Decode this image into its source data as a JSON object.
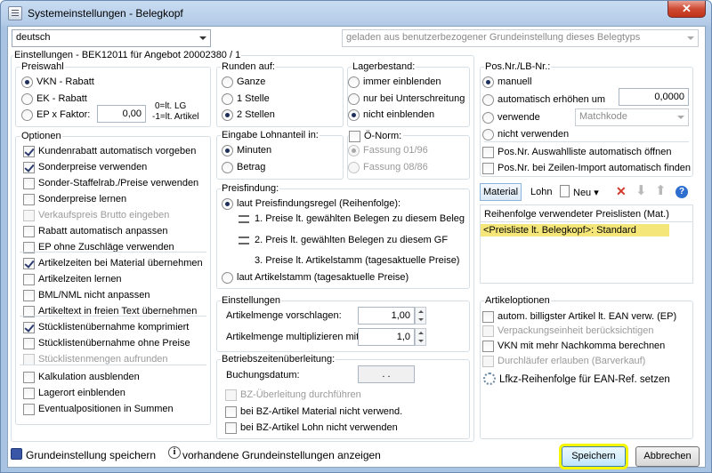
{
  "window": {
    "title": "Systemeinstellungen - Belegkopf",
    "close": "✕"
  },
  "top": {
    "language": "deutsch",
    "template": "geladen aus benutzerbezogener Grundeinstellung dieses Belegtyps"
  },
  "settings_caption": "Einstellungen - BEK12011 für Angebot 20002380 / 1",
  "preiswahl": {
    "title": "Preiswahl",
    "opt1": "VKN - Rabatt",
    "opt2": "EK - Rabatt",
    "opt3": "EP x Faktor:",
    "factor": "0,00",
    "note1": "0=lt. LG",
    "note2": "-1=lt. Artikel"
  },
  "runden": {
    "title": "Runden auf:",
    "opt1": "Ganze",
    "opt2": "1 Stelle",
    "opt3": "2 Stellen"
  },
  "lager": {
    "title": "Lagerbestand:",
    "opt1": "immer einblenden",
    "opt2": "nur bei Unterschreitung",
    "opt3": "nicht einblenden"
  },
  "posnr": {
    "title": "Pos.Nr./LB-Nr.:",
    "opt1": "manuell",
    "opt2": "automatisch erhöhen um",
    "value": "0,0000",
    "opt3": "verwende",
    "matchcode": "Matchkode",
    "opt4": "nicht verwenden",
    "chk1": "Pos.Nr. Auswahlliste automatisch öffnen",
    "chk2": "Pos.Nr. bei Zeilen-Import automatisch finden"
  },
  "optionen": {
    "title": "Optionen",
    "items": [
      "Kundenrabatt automatisch vorgeben",
      "Sonderpreise verwenden",
      "Sonder-Staffelrab./Preise verwenden",
      "Sonderpreise lernen",
      "Verkaufspreis Brutto eingeben",
      "Rabatt automatisch anpassen",
      "EP ohne Zuschläge verwenden",
      "Artikelzeiten bei Material übernehmen",
      "Artikelzeiten lernen",
      "BML/NML nicht anpassen",
      "Artikeltext in freien Text übernehmen",
      "Stücklistenübernahme komprimiert",
      "Stücklistenübernahme ohne Preise",
      "Stücklistenmengen aufrunden",
      "Kalkulation ausblenden",
      "Lagerort einblenden",
      "Eventualpositionen in Summen"
    ]
  },
  "lohnanteil": {
    "title": "Eingabe Lohnanteil in:",
    "opt1": "Minuten",
    "opt2": "Betrag"
  },
  "onorm": {
    "title": "Ö-Norm:",
    "opt1": "Fassung 01/96",
    "opt2": "Fassung 08/86"
  },
  "preisfindung": {
    "title": "Preisfindung:",
    "opt1": "laut Preisfindungsregel (Reihenfolge):",
    "rule1": "1. Preise lt. gewählten Belegen zu diesem Beleg",
    "rule2": "2. Preis lt. gewählten Belegen zu diesem GF",
    "rule3": "3. Preise lt. Artikelstamm (tagesaktuelle Preise)",
    "opt2": "laut Artikelstamm (tagesaktuelle Preise)"
  },
  "preislisten": {
    "tab_material": "Material",
    "tab_lohn": "Lohn",
    "new": "Neu",
    "header": "Reihenfolge verwendeter Preislisten (Mat.)",
    "entry": "<Preisliste lt. Belegkopf>: Standard"
  },
  "einstellungen": {
    "title": "Einstellungen",
    "label1": "Artikelmenge vorschlagen:",
    "value1": "1,00",
    "label2": "Artikelmenge multiplizieren mit:",
    "value2": "1,0"
  },
  "bz": {
    "title": "Betriebszeitenüberleitung:",
    "date_label": "Buchungsdatum:",
    "date_value": ". .",
    "chk1": "BZ-Überleitung durchführen",
    "chk2": "bei BZ-Artikel Material nicht verwend.",
    "chk3": "bei BZ-Artikel Lohn nicht verwenden"
  },
  "artikeloptionen": {
    "title": "Artikeloptionen",
    "chk1": "autom. billigster Artikel lt. EAN verw. (EP)",
    "chk2": "Verpackungseinheit berücksichtigen",
    "chk3": "VKN mit mehr Nachkomma berechnen",
    "chk4": "Durchläufer erlauben (Barverkauf)",
    "link": "Lfkz-Reihenfolge für EAN-Ref. setzen"
  },
  "footer": {
    "save_default": "Grundeinstellung speichern",
    "show_defaults": "vorhandene Grundeinstellungen anzeigen",
    "save": "Speichern",
    "cancel": "Abbrechen"
  },
  "colors": {
    "accent": "#f6f600",
    "selection": "#f5e67a",
    "check": "#2a3b6e"
  }
}
